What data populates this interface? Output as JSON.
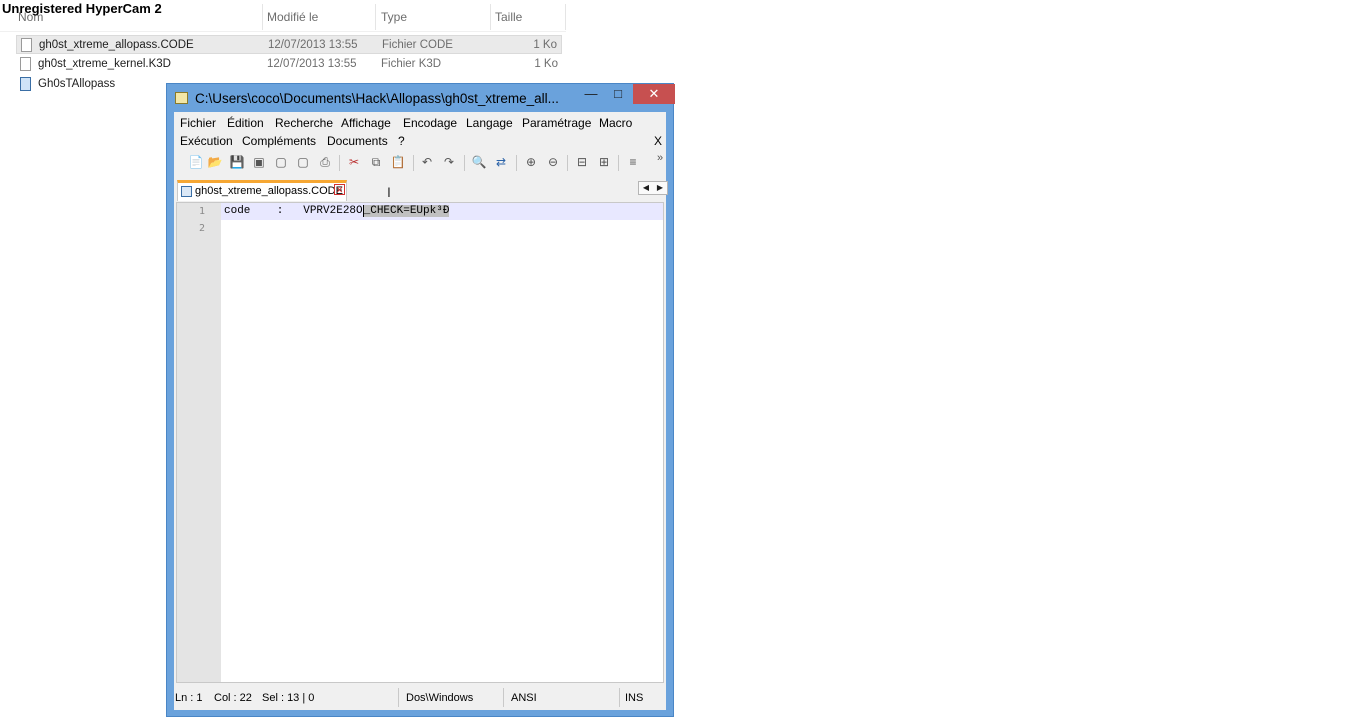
{
  "watermark": "Unregistered HyperCam 2",
  "explorer": {
    "columns": {
      "name": "Nom",
      "modified": "Modifié le",
      "type": "Type",
      "size": "Taille"
    },
    "files": [
      {
        "name": "gh0st_xtreme_allopass.CODE",
        "modified": "12/07/2013 13:55",
        "type": "Fichier CODE",
        "size": "1 Ko",
        "icon": "text-file-icon"
      },
      {
        "name": "gh0st_xtreme_kernel.K3D",
        "modified": "12/07/2013 13:55",
        "type": "Fichier K3D",
        "size": "1 Ko",
        "icon": "text-file-icon"
      },
      {
        "name": "Gh0sTAllopass",
        "icon": "application-icon"
      }
    ]
  },
  "window": {
    "title": "C:\\Users\\coco\\Documents\\Hack\\Allopass\\gh0st_xtreme_all...",
    "controls": {
      "minimize": "—",
      "maximize": "□",
      "close": "✕"
    },
    "menu": {
      "row1": [
        "Fichier",
        "Édition",
        "Recherche",
        "Affichage",
        "Encodage",
        "Langage",
        "Paramétrage",
        "Macro"
      ],
      "row2": [
        "Exécution",
        "Compléments",
        "Documents",
        "?"
      ],
      "close": "X"
    },
    "toolbar_icons": [
      "new-file-icon",
      "open-file-icon",
      "save-icon",
      "save-all-icon",
      "close-icon",
      "close-all-icon",
      "print-icon",
      "cut-icon",
      "copy-icon",
      "paste-icon",
      "undo-icon",
      "redo-icon",
      "find-icon",
      "replace-icon",
      "zoom-in-icon",
      "zoom-out-icon",
      "sync-v-icon",
      "sync-h-icon",
      "word-wrap-icon",
      "more-icon"
    ],
    "tab": {
      "label": "gh0st_xtreme_allopass.CODE",
      "close": "✕"
    },
    "tab_scroll": {
      "left": "◀",
      "right": "▶"
    },
    "editor": {
      "line_numbers": [
        "1",
        "2"
      ],
      "line1_prefix": "code    :   VPRV2E28O",
      "line1_selected": "_CHECK=EUpk³Ð",
      "line2": ""
    },
    "status": {
      "ln": "Ln : 1",
      "col": "Col : 22",
      "sel": "Sel : 13 | 0",
      "eol": "Dos\\Windows",
      "encoding": "ANSI",
      "mode": "INS"
    }
  }
}
